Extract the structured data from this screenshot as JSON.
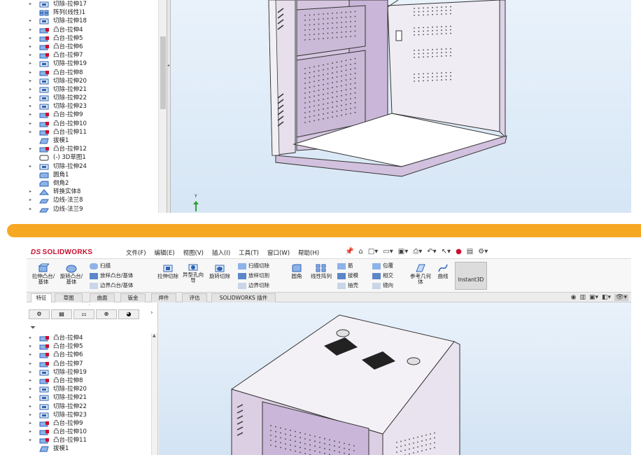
{
  "top_tree": {
    "items": [
      {
        "label": "切除-拉伸17",
        "icon": "cut-extrude-icon",
        "arrow": "▸"
      },
      {
        "label": "阵列(线性)1",
        "icon": "linear-pattern-icon",
        "arrow": ""
      },
      {
        "label": "切除-拉伸18",
        "icon": "cut-extrude-icon",
        "arrow": "▸"
      },
      {
        "label": "凸台-拉伸4",
        "icon": "boss-extrude-icon",
        "arrow": "▸"
      },
      {
        "label": "凸台-拉伸5",
        "icon": "boss-extrude-icon",
        "arrow": "▸"
      },
      {
        "label": "凸台-拉伸6",
        "icon": "boss-extrude-icon",
        "arrow": "▸"
      },
      {
        "label": "凸台-拉伸7",
        "icon": "boss-extrude-icon",
        "arrow": "▸"
      },
      {
        "label": "切除-拉伸19",
        "icon": "cut-extrude-icon",
        "arrow": "▸"
      },
      {
        "label": "凸台-拉伸8",
        "icon": "boss-extrude-icon",
        "arrow": "▸"
      },
      {
        "label": "切除-拉伸20",
        "icon": "cut-extrude-icon",
        "arrow": "▸"
      },
      {
        "label": "切除-拉伸21",
        "icon": "cut-extrude-icon",
        "arrow": "▸"
      },
      {
        "label": "切除-拉伸22",
        "icon": "cut-extrude-icon",
        "arrow": "▸"
      },
      {
        "label": "切除-拉伸23",
        "icon": "cut-extrude-icon",
        "arrow": "▸"
      },
      {
        "label": "凸台-拉伸9",
        "icon": "boss-extrude-icon",
        "arrow": "▸"
      },
      {
        "label": "凸台-拉伸10",
        "icon": "boss-extrude-icon",
        "arrow": "▸"
      },
      {
        "label": "凸台-拉伸11",
        "icon": "boss-extrude-icon",
        "arrow": "▸"
      },
      {
        "label": "拔模1",
        "icon": "draft-icon",
        "arrow": ""
      },
      {
        "label": "凸台-拉伸12",
        "icon": "boss-extrude-icon",
        "arrow": "▸"
      },
      {
        "label": "(-) 3D草图1",
        "icon": "3d-sketch-icon",
        "arrow": ""
      },
      {
        "label": "切除-拉伸24",
        "icon": "cut-extrude-icon",
        "arrow": "▸"
      },
      {
        "label": "圆角1",
        "icon": "fillet-icon",
        "arrow": ""
      },
      {
        "label": "倒角2",
        "icon": "chamfer-icon",
        "arrow": ""
      },
      {
        "label": "转换实体8",
        "icon": "convert-entities-icon",
        "arrow": "▸"
      },
      {
        "label": "边线-法兰8",
        "icon": "edge-flange-icon",
        "arrow": "▸"
      },
      {
        "label": "边线-法兰9",
        "icon": "edge-flange-icon",
        "arrow": "▸"
      }
    ]
  },
  "triad_label": "Y",
  "app": {
    "brand_ds": "DS",
    "brand_name": "SOLIDWORKS"
  },
  "menu": [
    "文件(F)",
    "编辑(E)",
    "视图(V)",
    "插入(I)",
    "工具(T)",
    "窗口(W)",
    "帮助(H)"
  ],
  "ribbon": {
    "extrude_boss": "拉伸凸台/基体",
    "revolve_boss": "旋转凸台/基体",
    "sweep": "扫描",
    "loft": "放样凸台/基体",
    "boundary_boss": "边界凸台/基体",
    "extrude_cut": "拉伸切除",
    "hole_wizard": "异型孔向导",
    "revolve_cut": "旋转切除",
    "swept_cut": "扫描切除",
    "lofted_cut": "放样切割",
    "boundary_cut": "边界切除",
    "fillet": "圆角",
    "linear_pattern": "线性阵列",
    "rib": "筋",
    "draft": "拔模",
    "shell": "抽壳",
    "wrap": "包覆",
    "intersect": "相交",
    "mirror": "镜向",
    "ref_geometry": "参考几何体",
    "curves": "曲线",
    "instant3d": "Instant3D"
  },
  "tabs": [
    "特征",
    "草图",
    "曲面",
    "钣金",
    "焊件",
    "评估",
    "SOLIDWORKS 插件"
  ],
  "active_tab": "特征",
  "bottom_tree": {
    "items": [
      {
        "label": "凸台-拉伸4",
        "icon": "boss-extrude-icon",
        "arrow": "▸"
      },
      {
        "label": "凸台-拉伸5",
        "icon": "boss-extrude-icon",
        "arrow": "▸"
      },
      {
        "label": "凸台-拉伸6",
        "icon": "boss-extrude-icon",
        "arrow": "▸"
      },
      {
        "label": "凸台-拉伸7",
        "icon": "boss-extrude-icon",
        "arrow": "▸"
      },
      {
        "label": "切除-拉伸19",
        "icon": "cut-extrude-icon",
        "arrow": "▸"
      },
      {
        "label": "凸台-拉伸8",
        "icon": "boss-extrude-icon",
        "arrow": "▸"
      },
      {
        "label": "切除-拉伸20",
        "icon": "cut-extrude-icon",
        "arrow": "▸"
      },
      {
        "label": "切除-拉伸21",
        "icon": "cut-extrude-icon",
        "arrow": "▸"
      },
      {
        "label": "切除-拉伸22",
        "icon": "cut-extrude-icon",
        "arrow": "▸"
      },
      {
        "label": "切除-拉伸23",
        "icon": "cut-extrude-icon",
        "arrow": "▸"
      },
      {
        "label": "凸台-拉伸9",
        "icon": "boss-extrude-icon",
        "arrow": "▸"
      },
      {
        "label": "凸台-拉伸10",
        "icon": "boss-extrude-icon",
        "arrow": "▸"
      },
      {
        "label": "凸台-拉伸11",
        "icon": "boss-extrude-icon",
        "arrow": "▸"
      },
      {
        "label": "拔模1",
        "icon": "draft-icon",
        "arrow": ""
      }
    ]
  },
  "colors": {
    "accent_orange": "#f7a823",
    "brand_red": "#c8102e",
    "cabinet_fill": "#dccfe4",
    "cabinet_panel": "#c9b6d8",
    "cabinet_top": "#f4f1f6",
    "viewport_bg": "#dbe8f6",
    "icon_blue": "#2f63b4"
  }
}
